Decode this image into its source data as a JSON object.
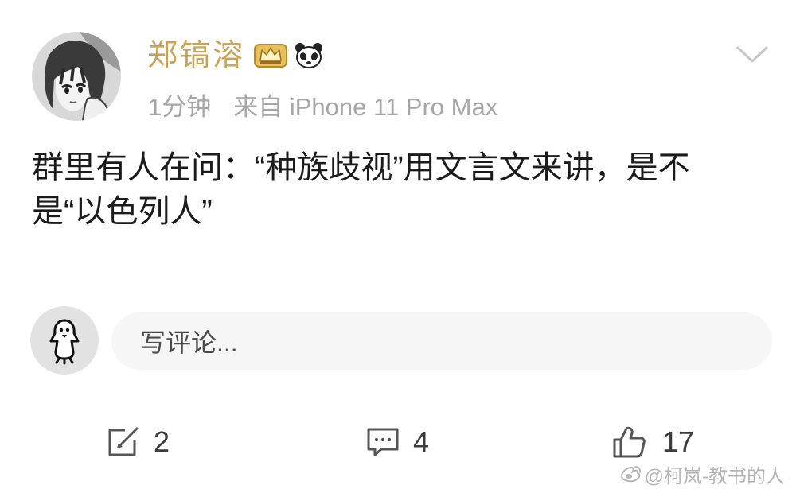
{
  "post": {
    "author": {
      "name": "郑镐溶",
      "avatar_icon": "anime-girl-avatar",
      "badges": [
        {
          "icon": "gold-member-badge-icon"
        },
        {
          "icon": "panda-badge-icon"
        }
      ]
    },
    "time": "1分钟",
    "source": "来自 iPhone 11 Pro Max",
    "text_lines": [
      "群里有人在问：“种族歧视”用文言文来讲，是不",
      "是“以色列人”"
    ],
    "menu_icon": "chevron-down-icon"
  },
  "comment_box": {
    "avatar_icon": "penguin-avatar",
    "placeholder": "写评论..."
  },
  "actions": {
    "repost": {
      "icon": "repost-icon",
      "count": 2
    },
    "comment": {
      "icon": "comment-icon",
      "count": 4
    },
    "like": {
      "icon": "thumbs-up-icon",
      "count": 17
    }
  },
  "watermark": {
    "icon": "weibo-logo-icon",
    "text": "@柯岚-教书的人"
  },
  "colors": {
    "text": "#1b1b1b",
    "meta": "#a6a6a6",
    "name_color": "#c9a255",
    "icon": "#555555",
    "count": "#3a3a3a",
    "input_bg": "#f6f6f6",
    "watermark": "#b5b5b5"
  }
}
